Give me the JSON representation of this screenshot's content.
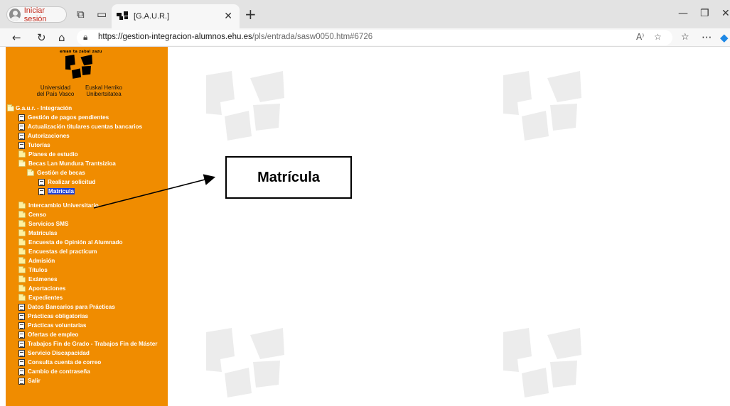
{
  "browser": {
    "signin_label": "Iniciar sesión",
    "tab_title": "[G.A.U.R.]",
    "url_host": "https://gestion-integracion-alumnos.ehu.es",
    "url_path": "/pls/entrada/sasw0050.htm#6726"
  },
  "logo": {
    "top_text": "eman ta zabal zazu",
    "left_text_1": "Universidad",
    "left_text_2": "del País Vasco",
    "right_text_1": "Euskal Herriko",
    "right_text_2": "Unibertsitatea"
  },
  "tree": {
    "root": "G.a.u.r. - Integración",
    "items": [
      "Gestión de pagos pendientes",
      "Actualización titulares cuentas bancarios",
      "Autorizaciones",
      "Tutorías",
      "Planes de estudio",
      "Becas Lan Mundura Trantsizioa",
      "Gestión de becas",
      "Realizar solicitud",
      "Matrícula",
      "Intercambio Universitario",
      "Censo",
      "Servicios SMS",
      "Matrículas",
      "Encuesta de Opinión al Alumnado",
      "Encuestas del practicum",
      "Admisión",
      "Títulos",
      "Exámenes",
      "Aportaciones",
      "Expedientes",
      "Datos Bancarios para Prácticas",
      "Prácticas obligatorias",
      "Prácticas voluntarias",
      "Ofertas de empleo",
      "Trabajos Fin de Grado - Trabajos Fin de Máster",
      "Servicio Discapacidad",
      "Consulta cuenta de correo",
      "Cambio de contraseña",
      "Salir"
    ]
  },
  "callout": {
    "text": "Matrícula"
  },
  "colors": {
    "sidebar": "#f08c00",
    "selection": "#1c3fd8",
    "watermark": "#ececec"
  }
}
